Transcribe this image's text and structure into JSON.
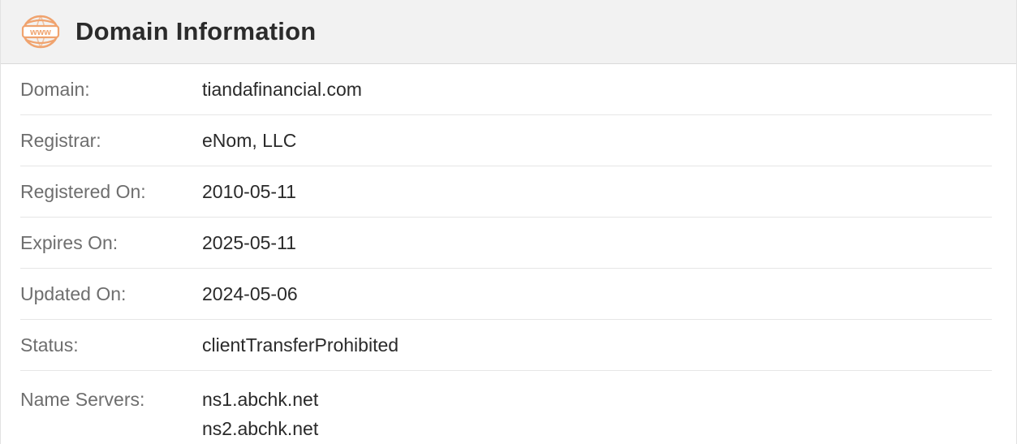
{
  "header": {
    "title": "Domain Information",
    "icon": "www-globe-icon",
    "icon_text": "www",
    "icon_color": "#f0a36e"
  },
  "rows": [
    {
      "label": "Domain:",
      "value": "tiandafinancial.com"
    },
    {
      "label": "Registrar:",
      "value": "eNom, LLC"
    },
    {
      "label": "Registered On:",
      "value": "2010-05-11"
    },
    {
      "label": "Expires On:",
      "value": "2025-05-11"
    },
    {
      "label": "Updated On:",
      "value": "2024-05-06"
    },
    {
      "label": "Status:",
      "value": "clientTransferProhibited"
    }
  ],
  "name_servers": {
    "label": "Name Servers:",
    "values": [
      "ns1.abchk.net",
      "ns2.abchk.net"
    ]
  }
}
